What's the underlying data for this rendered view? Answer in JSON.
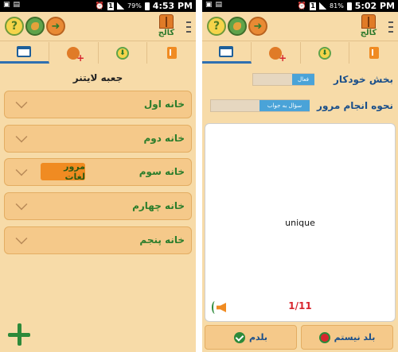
{
  "left": {
    "status": {
      "battery": "79%",
      "time": "4:53 PM",
      "sim": "1"
    },
    "app": {
      "logo_text": "کالج"
    },
    "box_title": "جعبه لایتنر",
    "boxes": [
      {
        "label": "خانه اول"
      },
      {
        "label": "خانه دوم"
      },
      {
        "label": "خانه سوم",
        "badge": "مرور لغات"
      },
      {
        "label": "خانه چهارم"
      },
      {
        "label": "خانه پنجم"
      }
    ],
    "icons": {
      "add": "plus-icon"
    }
  },
  "right": {
    "status": {
      "battery": "81%",
      "time": "5:02 PM",
      "sim": "1"
    },
    "app": {
      "logo_text": "کالج"
    },
    "settings": {
      "auto_label": "بخش خودکار",
      "auto_value": "فعال",
      "review_label": "نحوه انجام مرور",
      "review_value": "سؤال به جواب"
    },
    "card": {
      "word": "unique",
      "counter": "1/11"
    },
    "buttons": {
      "know": "بلدم",
      "dont_know": "بلد نیستم"
    }
  },
  "colors": {
    "background": "#f7dba8",
    "row": "#f5c98a",
    "green_text": "#2b7d2b",
    "blue_text": "#1a4f8a",
    "accent_orange": "#f08b22",
    "counter_red": "#d8262e"
  }
}
